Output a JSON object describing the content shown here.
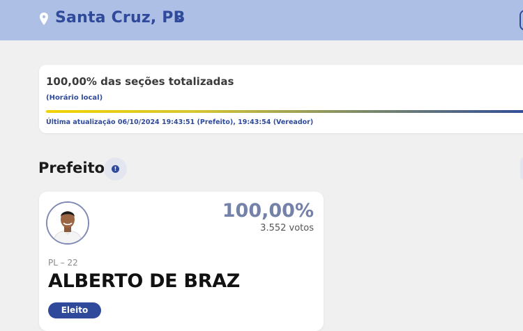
{
  "header": {
    "location": "Santa Cruz, PB"
  },
  "status": {
    "sections_totalized": "100,00% das seções totalizadas",
    "time_note": "(Horário local)",
    "progress_fraction": 1.0,
    "last_update": "Última atualização 06/10/2024 19:43:51 (Prefeito), 19:43:54 (Vereador)"
  },
  "section": {
    "title": "Prefeito",
    "info_symbol": "!"
  },
  "candidate": {
    "percent": "100,00%",
    "votes": "3.552 votos",
    "party": "PL – 22",
    "name": "ALBERTO DE BRAZ",
    "status_badge": "Eleito"
  },
  "icons": {
    "location": "location-pin-icon",
    "dropdown": "chevron-down-icon",
    "info": "info-icon"
  },
  "colors": {
    "header_bg": "#aebfe6",
    "accent": "#2f4a9a",
    "percent_text": "#7481a8"
  }
}
